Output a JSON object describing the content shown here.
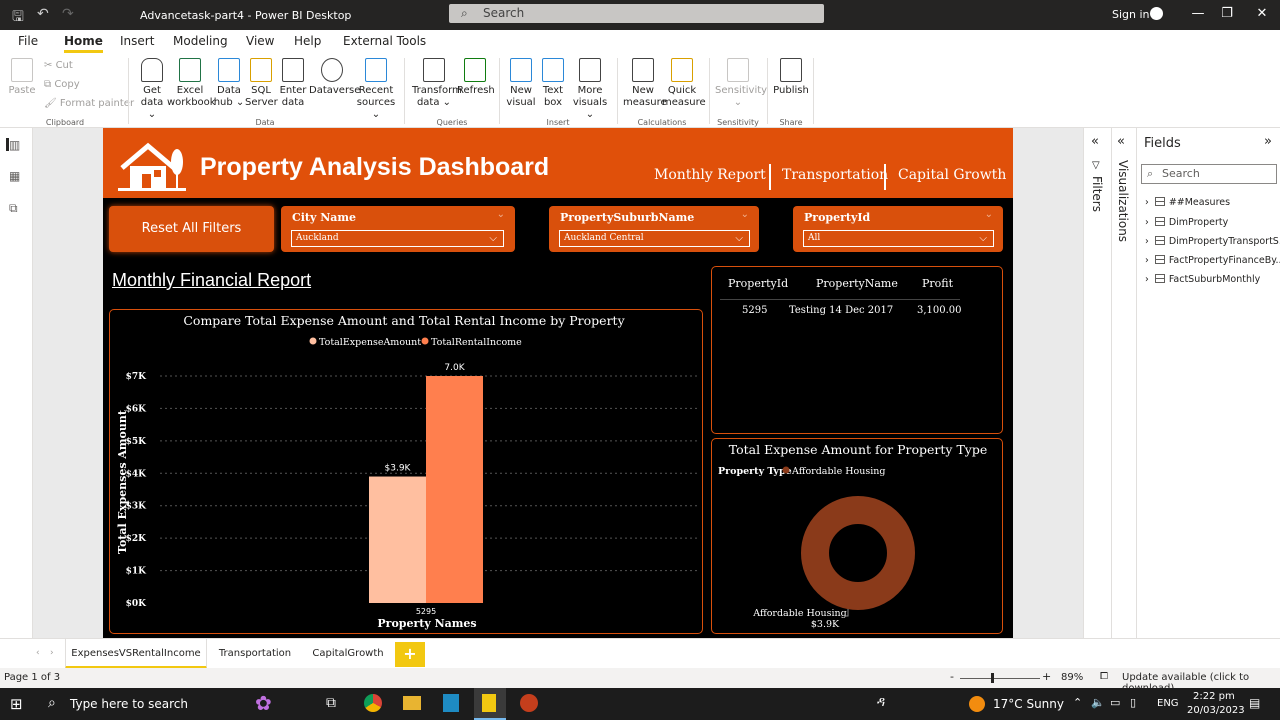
{
  "window": {
    "title": "Advancetask-part4 - Power BI Desktop",
    "search_placeholder": "Search",
    "signin": "Sign in"
  },
  "menu": [
    "File",
    "Home",
    "Insert",
    "Modeling",
    "View",
    "Help",
    "External Tools"
  ],
  "ribbon": {
    "clipboard": {
      "paste": "Paste",
      "cut": "Cut",
      "copy": "Copy",
      "format_painter": "Format painter",
      "group": "Clipboard"
    },
    "data": {
      "get_data": "Get",
      "get_data2": "data",
      "excel": "Excel",
      "excel2": "workbook",
      "datahub": "Data",
      "datahub2": "hub",
      "sql": "SQL",
      "sql2": "Server",
      "enter": "Enter",
      "enter2": "data",
      "dataverse": "Dataverse",
      "recent": "Recent",
      "recent2": "sources",
      "group": "Data"
    },
    "queries": {
      "transform": "Transform",
      "transform2": "data",
      "refresh": "Refresh",
      "group": "Queries"
    },
    "insert": {
      "new_visual": "New",
      "new_visual2": "visual",
      "textbox": "Text",
      "textbox2": "box",
      "more": "More",
      "more2": "visuals",
      "group": "Insert"
    },
    "calculations": {
      "new_measure": "New",
      "new_measure2": "measure",
      "quick": "Quick",
      "quick2": "measure",
      "group": "Calculations"
    },
    "sensitivity": {
      "label": "Sensitivity",
      "group": "Sensitivity"
    },
    "share": {
      "publish": "Publish",
      "group": "Share"
    }
  },
  "report": {
    "title": "Property Analysis Dashboard",
    "nav": [
      "Monthly Report",
      "Transportation",
      "Capital Growth"
    ],
    "reset": "Reset All Filters",
    "slicers": [
      {
        "label": "City Name",
        "value": "Auckland"
      },
      {
        "label": "PropertySuburbName",
        "value": "Auckland Central"
      },
      {
        "label": "PropertyId",
        "value": "All"
      }
    ],
    "section_title": "Monthly Financial Report",
    "table": {
      "headers": [
        "PropertyId",
        "PropertyName",
        "Profit"
      ],
      "rows": [
        [
          "5295",
          "Testing 14 Dec 2017",
          "3,100.00"
        ]
      ]
    }
  },
  "chart_data": [
    {
      "type": "bar",
      "title": "Compare Total Expense Amount and Total Rental Income by Property",
      "xlabel": "Property Names",
      "ylabel": "Total Expenses Amount",
      "categories": [
        "5295"
      ],
      "series": [
        {
          "name": "TotalExpenseAmount",
          "values": [
            3900
          ],
          "color": "#ffbfa0",
          "label": "$3.9K"
        },
        {
          "name": "TotalRentalIncome",
          "values": [
            7000
          ],
          "color": "#ff7f4e",
          "label": "7.0K"
        }
      ],
      "ylim": [
        0,
        7000
      ],
      "yticks": [
        "$0K",
        "$1K",
        "$2K",
        "$3K",
        "$4K",
        "$5K",
        "$6K",
        "$7K"
      ],
      "legend": "top-center",
      "grid": true
    },
    {
      "type": "pie",
      "title": "Total Expense Amount for Property Type",
      "legend_title": "Property Type",
      "categories": [
        "Affordable Housing"
      ],
      "values": [
        3900
      ],
      "data_labels": [
        "Affordable Housing",
        "$3.9K"
      ],
      "color": "#8a3a1a"
    }
  ],
  "panes": {
    "filters": "Filters",
    "visualizations": "Visualizations",
    "fields_title": "Fields",
    "fields_search": "Search",
    "fields": [
      "##Measures",
      "DimProperty",
      "DimPropertyTransportS...",
      "FactPropertyFinanceBy...",
      "FactSuburbMonthly"
    ]
  },
  "tabs": [
    "ExpensesVSRentalIncome",
    "Transportation",
    "CapitalGrowth"
  ],
  "status": {
    "page": "Page 1 of 3",
    "zoom": "89%",
    "update": "Update available (click to download)"
  },
  "taskbar": {
    "search": "Type here to search",
    "weather": "17°C  Sunny",
    "lang": "ENG",
    "time": "2:22 pm",
    "date": "20/03/2023"
  }
}
